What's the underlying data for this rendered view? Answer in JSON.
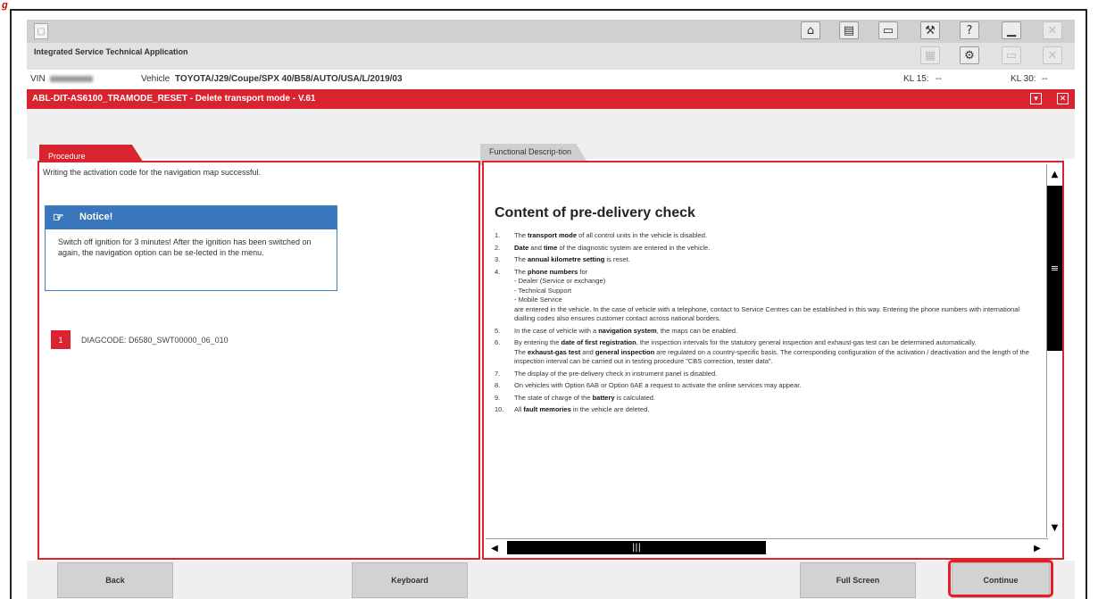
{
  "figure_label": "g",
  "toolbar": {
    "icons_top": [
      "home-icon",
      "documents-icon",
      "vehicle-icon",
      "wrench-icon",
      "help-icon",
      "minimize-icon",
      "close-icon"
    ],
    "icons_second": [
      "disabled-icon",
      "settings-gear-icon",
      "window-icon",
      "close-small-icon"
    ],
    "help_glyph": "?"
  },
  "app": {
    "title": "Integrated Service Technical Application"
  },
  "vehicle_row": {
    "vin_label": "VIN",
    "vehicle_label": "Vehicle",
    "vehicle_value": "TOYOTA/J29/Coupe/SPX 40/B58/AUTO/USA/L/2019/03",
    "kl15_label": "KL 15:",
    "kl15_value": "--",
    "kl30_label": "KL 30:",
    "kl30_value": "--"
  },
  "title_bar": {
    "title": "ABL-DIT-AS6100_TRAMODE_RESET - Delete transport mode - V.61"
  },
  "tabs": [
    {
      "label": "Procedure"
    },
    {
      "label": "Functional Descrip-tion"
    }
  ],
  "procedure": {
    "message": "Writing the activation code for the navigation map successful.",
    "notice": {
      "title": "Notice!",
      "text": "Switch off ignition for 3 minutes! After the ignition has been switched on again, the navigation option can be se-lected in the menu."
    },
    "diag": {
      "number": "1",
      "code": "DIAGCODE: D6580_SWT00000_06_010"
    }
  },
  "description": {
    "title": "Content of pre-delivery check",
    "items": [
      {
        "num": "1.",
        "html": "The <b>transport mode</b> of all control units in the vehicle is disabled."
      },
      {
        "num": "2.",
        "html": "<b>Date</b> and <b>time</b> of the diagnostic system are entered in the vehicle."
      },
      {
        "num": "3.",
        "html": "The <b>annual kilometre setting</b> is reset."
      },
      {
        "num": "4.",
        "html": "The <b>phone numbers</b> for<br>- Dealer (Service or exchange)<br>- Technical Support<br>- Mobile Service<br>are entered in the vehicle. In the case of vehicle with a telephone, contact to Service Centres can be established in this way. Entering the phone numbers with international dialling codes also ensures customer contact across national borders."
      },
      {
        "num": "5.",
        "html": "In the case of vehicle with a <b>navigation system</b>, the maps can be enabled."
      },
      {
        "num": "6.",
        "html": "By entering the <b>date of first registration</b>, the inspection intervals for the statutory general inspection and exhaust-gas test can be determined automatically.<br>The <b>exhaust-gas test</b> and <b>general inspection</b> are regulated on a country-specific basis. The corresponding configuration of the activation / deactivation and the length of the inspection interval can be carried out in testing procedure \"CBS correction, tester data\"."
      },
      {
        "num": "7.",
        "html": "The display of the pre-delivery check in instrument panel is disabled."
      },
      {
        "num": "8.",
        "html": "On vehicles with Option 6AB or Option 6AE a request to activate the online services may appear."
      },
      {
        "num": "9.",
        "html": "The state of charge of the <b>battery</b> is calculated."
      },
      {
        "num": "10.",
        "html": "All <b>fault memories</b> in the vehicle are deleted."
      }
    ]
  },
  "scroll": {
    "up": "▲",
    "down": "▼",
    "left": "◀",
    "right": "▶",
    "vthumb_grip": "≡",
    "hthumb_grip": "|||"
  },
  "buttons": {
    "back": "Back",
    "keyboard": "Keyboard",
    "full_screen": "Full Screen",
    "continue": "Continue"
  },
  "colors": {
    "accent_red": "#d9232e",
    "notice_blue": "#3a76bb",
    "highlight_red": "#e51e25"
  }
}
